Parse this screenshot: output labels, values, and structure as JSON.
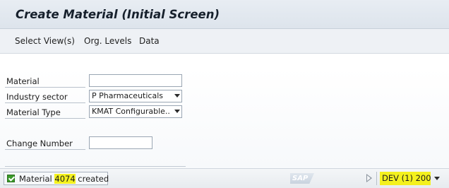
{
  "window": {
    "title": "Create Material (Initial Screen)"
  },
  "toolbar": {
    "buttons": [
      {
        "label": "Select View(s)"
      },
      {
        "label": "Org. Levels"
      },
      {
        "label": "Data"
      }
    ]
  },
  "form": {
    "material": {
      "label": "Material",
      "value": ""
    },
    "industry_sector": {
      "label": "Industry sector",
      "value": "P Pharmaceuticals"
    },
    "material_type": {
      "label": "Material Type",
      "value": "KMAT Configurable..."
    },
    "change_number": {
      "label": "Change Number",
      "value": ""
    }
  },
  "status": {
    "message_prefix": "Material ",
    "message_number": "4074",
    "message_suffix": " created",
    "system_info": "DEV (1) 200",
    "logo_text": "SAP"
  },
  "colors": {
    "highlight": "#f4f11e",
    "success": "#3b9a2a"
  }
}
